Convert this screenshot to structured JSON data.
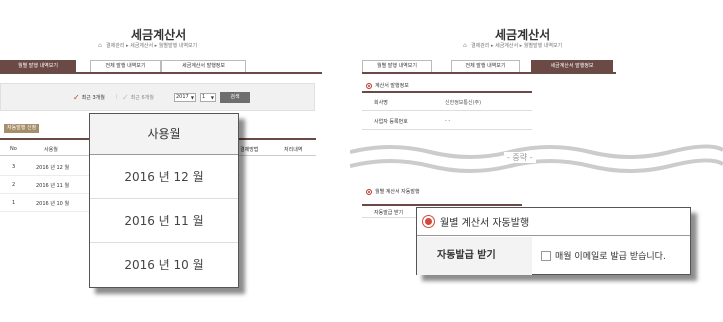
{
  "left": {
    "title": "세금계산서",
    "breadcrumb": "결제관리 ▸ 세금계산서 ▸ 월별발행 내역보기",
    "tabs": [
      {
        "label": "월별 발행 내역보기",
        "active": true
      },
      {
        "label": "전체 발행 내역보기",
        "active": false
      },
      {
        "label": "세금계산서 발행정보",
        "active": false
      }
    ],
    "filter": {
      "recent3": "최근 3개월",
      "recent6": "최근 6개월",
      "year": "2017",
      "month": "1",
      "search_label": "검색"
    },
    "badge": "자동발행 신청",
    "table": {
      "headers": [
        "No",
        "사용월",
        "결제방법",
        "처리내역"
      ],
      "rows": [
        {
          "no": "3",
          "month": "2016 년 12 월"
        },
        {
          "no": "2",
          "month": "2016 년 11 월"
        },
        {
          "no": "1",
          "month": "2016 년 10 월"
        }
      ]
    },
    "popup": {
      "header": "사용월",
      "items": [
        "2016 년 12 월",
        "2016 년 11 월",
        "2016 년 10 월"
      ]
    }
  },
  "right": {
    "title": "세금계산서",
    "breadcrumb": "결제관리 ▸ 세금계산서 ▸ 월별발행 내역보기",
    "tabs": [
      {
        "label": "월별 발행 내역보기",
        "active": false
      },
      {
        "label": "전체 발행 내역보기",
        "active": false
      },
      {
        "label": "세금계산서 발행정보",
        "active": true
      }
    ],
    "section1": "계산서 발행정보",
    "info": [
      {
        "key": "회사명",
        "value": "신한정보통신(주)"
      },
      {
        "key": "사업자 등록번호",
        "value": "- -"
      }
    ],
    "omitted": "- 중략 -",
    "section2": "월별 계산서 자동발행",
    "auto_key_small": "자동발급 받기",
    "popup": {
      "header": "월별 계산서 자동발행",
      "key": "자동발급 받기",
      "checkbox_label": "매월 이메일로 발급 받습니다."
    }
  },
  "colors": {
    "brand": "#6b4a45",
    "accent": "#c0392b",
    "badge": "#a58f6a"
  }
}
